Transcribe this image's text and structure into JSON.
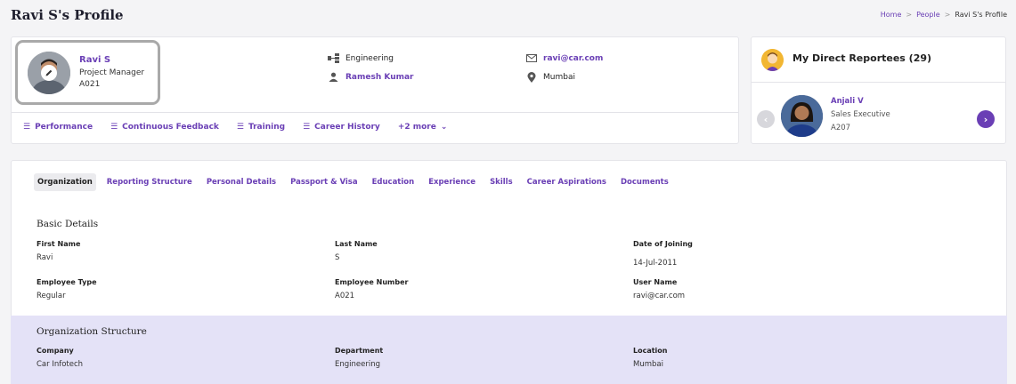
{
  "page": {
    "title": "Ravi S's Profile"
  },
  "breadcrumb": {
    "home": "Home",
    "people": "People",
    "current": "Ravi S's Profile",
    "separator": ">"
  },
  "profile": {
    "name": "Ravi S",
    "role": "Project Manager",
    "employee_id": "A021",
    "department": "Engineering",
    "manager": "Ramesh Kumar",
    "email": "ravi@car.com",
    "location": "Mumbai"
  },
  "quick_links": {
    "performance": "Performance",
    "continuous_feedback": "Continuous Feedback",
    "training": "Training",
    "career_history": "Career History",
    "more": "+2 more"
  },
  "reportees": {
    "title": "My Direct Reportees (29)",
    "current": {
      "name": "Anjali V",
      "role": "Sales Executive",
      "id": "A207"
    }
  },
  "tabs": {
    "organization": "Organization",
    "reporting_structure": "Reporting Structure",
    "personal_details": "Personal Details",
    "passport_visa": "Passport & Visa",
    "education": "Education",
    "experience": "Experience",
    "skills": "Skills",
    "career_aspirations": "Career Aspirations",
    "documents": "Documents"
  },
  "basic_details": {
    "title": "Basic Details",
    "first_name_label": "First Name",
    "first_name": "Ravi",
    "last_name_label": "Last Name",
    "last_name": "S",
    "doj_label": "Date of Joining",
    "doj": "14-Jul-2011",
    "emp_type_label": "Employee Type",
    "emp_type": "Regular",
    "emp_number_label": "Employee Number",
    "emp_number": "A021",
    "username_label": "User Name",
    "username": "ravi@car.com"
  },
  "org_structure": {
    "title": "Organization Structure",
    "company_label": "Company",
    "company": "Car Infotech",
    "department_label": "Department",
    "department": "Engineering",
    "location_label": "Location",
    "location": "Mumbai"
  },
  "colors": {
    "accent": "#6a3fb5",
    "band": "#e4e2f7"
  }
}
